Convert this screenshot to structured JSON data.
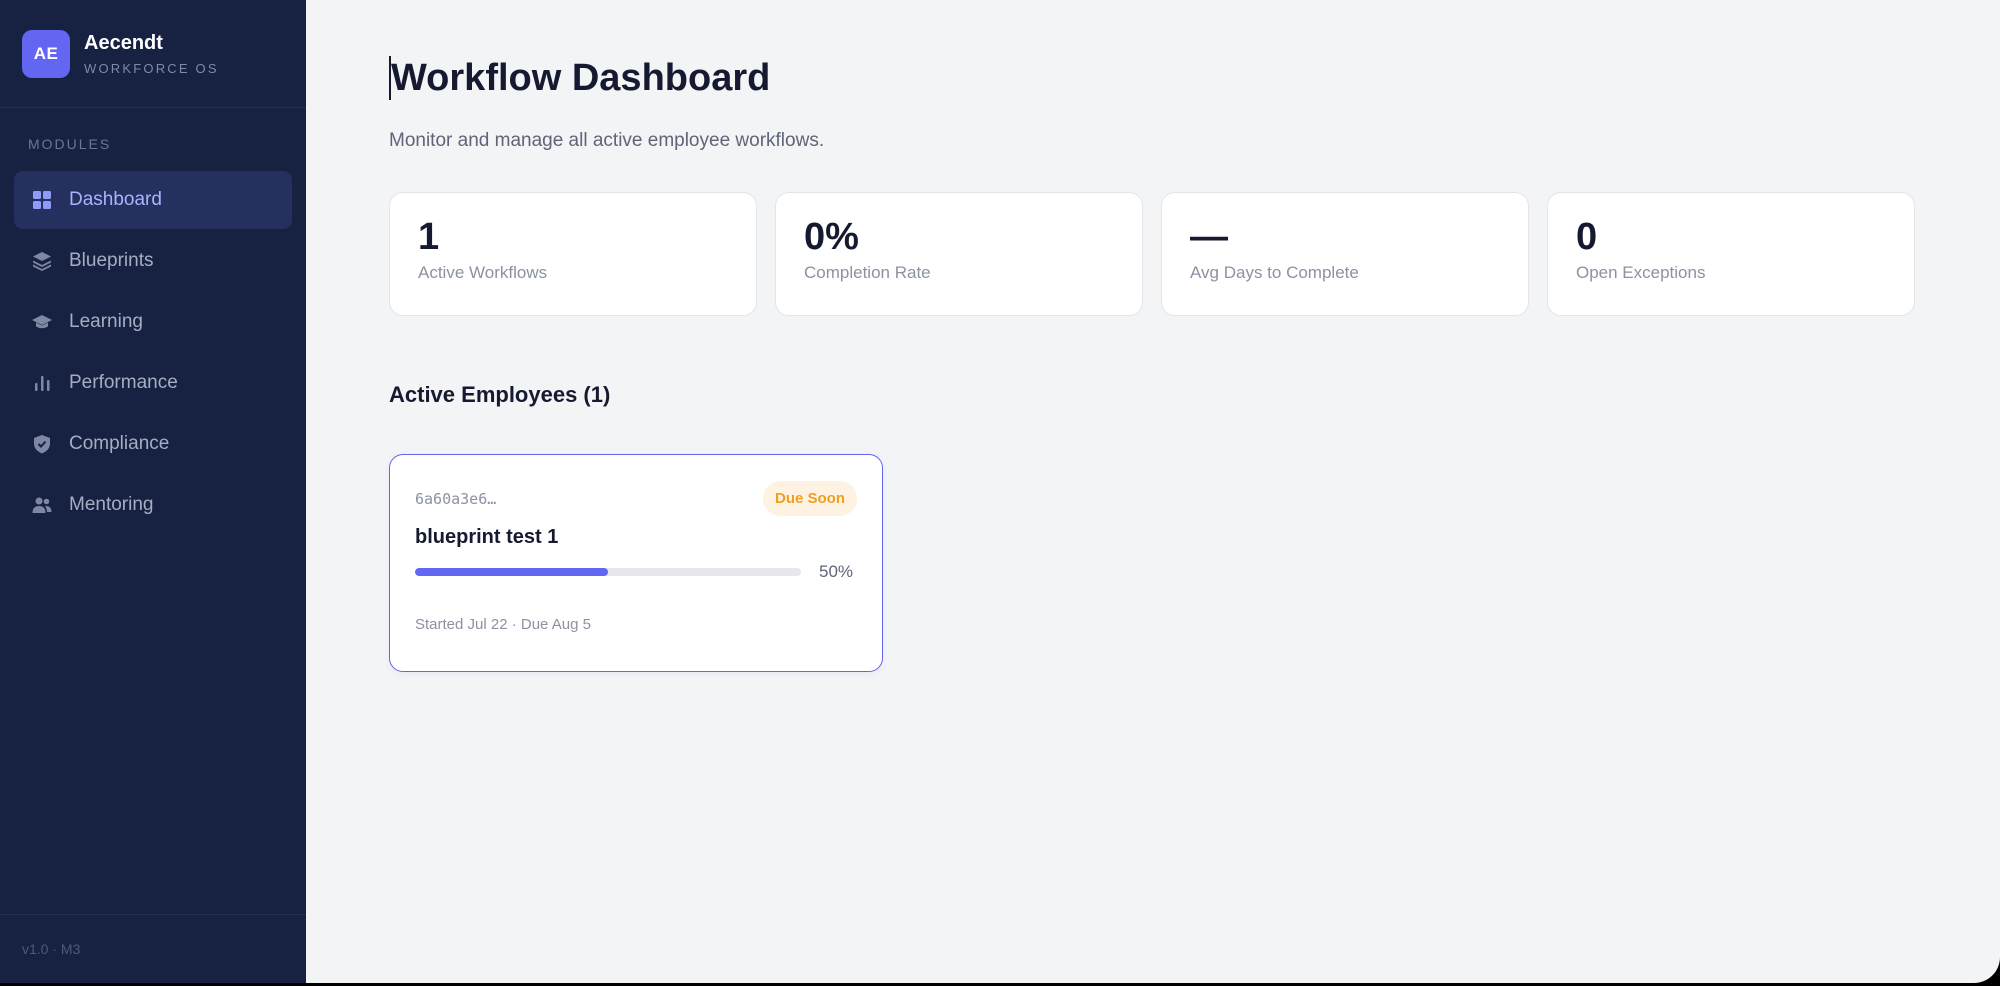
{
  "brand": {
    "initials": "AE",
    "name": "Aecendt",
    "subtitle": "WORKFORCE OS"
  },
  "sidebar": {
    "section_label": "MODULES",
    "items": [
      {
        "label": "Dashboard",
        "icon": "dashboard-grid-icon",
        "active": true
      },
      {
        "label": "Blueprints",
        "icon": "layers-icon",
        "active": false
      },
      {
        "label": "Learning",
        "icon": "graduation-cap-icon",
        "active": false
      },
      {
        "label": "Performance",
        "icon": "bar-chart-icon",
        "active": false
      },
      {
        "label": "Compliance",
        "icon": "shield-check-icon",
        "active": false
      },
      {
        "label": "Mentoring",
        "icon": "users-icon",
        "active": false
      }
    ],
    "version": "v1.0 · M3"
  },
  "main": {
    "title": "Workflow Dashboard",
    "subtitle": "Monitor and manage all active employee workflows.",
    "stats": [
      {
        "value": "1",
        "label": "Active Workflows"
      },
      {
        "value": "0%",
        "label": "Completion Rate"
      },
      {
        "value": "—",
        "label": "Avg Days to Complete"
      },
      {
        "value": "0",
        "label": "Open Exceptions"
      }
    ],
    "section_title": "Active Employees (1)",
    "employees": [
      {
        "id": "6a60a3e6…",
        "badge": "Due Soon",
        "name": "blueprint test 1",
        "progress": 50,
        "progress_label": "50%",
        "dates": "Started Jul 22 · Due Aug 5"
      }
    ]
  },
  "colors": {
    "accent": "#6366f1",
    "sidebar_bg": "#172142",
    "badge_text": "#f0a020",
    "badge_bg": "#fef3e2"
  }
}
